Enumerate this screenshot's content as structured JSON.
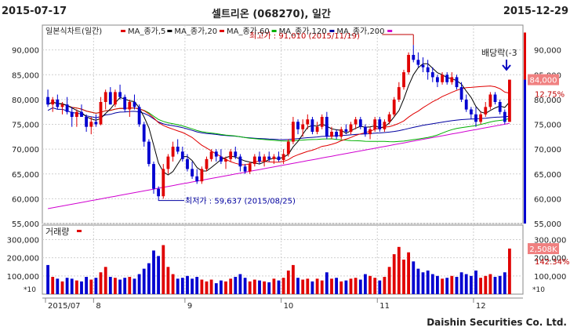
{
  "header": {
    "start_date": "2015-07-17",
    "title": "셀트리온 (068270), 일간",
    "end_date": "2015-12-29"
  },
  "footer": "Daishin Securities Co. Ltd.",
  "legend": {
    "main": "일본식차트(일간)",
    "ma": [
      {
        "label": "MA_종가,5",
        "color": "#e00000"
      },
      {
        "label": "MA_종가,20",
        "color": "#000000"
      },
      {
        "label": "MA_종가,60",
        "color": "#e00000"
      },
      {
        "label": "MA_종가,120",
        "color": "#00b000"
      },
      {
        "label": "MA_종가,200",
        "color": "#0000a0"
      },
      {
        "label": "",
        "color": "#d000d0"
      }
    ],
    "volume": "거래량"
  },
  "annotations": {
    "high": "최고가 : 91,010 (2015/11/19)",
    "low": "최저가 : 59,637 (2015/08/25)",
    "dividend": "배당락(-3",
    "last_price": "84,000",
    "last_change": "12.75%",
    "last_volume": "2,508K",
    "volume_change": "142.34%",
    "scale_note": "*10"
  },
  "colors": {
    "up": "#e00000",
    "down": "#0000d0"
  },
  "chart_data": {
    "type": "candlestick",
    "title": "셀트리온 (068270), 일간",
    "ylim": [
      55000,
      95000
    ],
    "yticks": [
      55000,
      60000,
      65000,
      70000,
      75000,
      80000,
      85000,
      90000
    ],
    "volume_ylim": [
      0,
      380000
    ],
    "volume_yticks": [
      100000,
      200000,
      300000
    ],
    "month_labels": [
      {
        "label": "2015/07",
        "index": 0
      },
      {
        "label": "8",
        "index": 10
      },
      {
        "label": "9",
        "index": 29
      },
      {
        "label": "10",
        "index": 49
      },
      {
        "label": "11",
        "index": 69
      },
      {
        "label": "12",
        "index": 89
      }
    ],
    "candles": [
      [
        80500,
        82000,
        78500,
        79000,
        160000
      ],
      [
        79000,
        80500,
        77500,
        80000,
        95000
      ],
      [
        80000,
        81000,
        78000,
        78500,
        85000
      ],
      [
        78500,
        79500,
        77000,
        79000,
        70000
      ],
      [
        79000,
        80500,
        77000,
        77500,
        90000
      ],
      [
        77500,
        78500,
        74500,
        76500,
        85000
      ],
      [
        76500,
        78000,
        74500,
        77500,
        75000
      ],
      [
        77500,
        79000,
        76500,
        76500,
        70000
      ],
      [
        76500,
        77000,
        73500,
        74500,
        95000
      ],
      [
        74500,
        76500,
        73000,
        75500,
        80000
      ],
      [
        75500,
        77000,
        74500,
        75000,
        90000
      ],
      [
        75000,
        80500,
        74800,
        79500,
        120000
      ],
      [
        79500,
        82000,
        78000,
        81500,
        150000
      ],
      [
        81500,
        82500,
        79000,
        79000,
        95000
      ],
      [
        79000,
        82000,
        78500,
        81500,
        90000
      ],
      [
        81500,
        83000,
        80000,
        80500,
        80000
      ],
      [
        80500,
        81000,
        77500,
        78000,
        90000
      ],
      [
        78000,
        80000,
        76500,
        79500,
        95000
      ],
      [
        79500,
        81000,
        78000,
        78500,
        85000
      ],
      [
        78500,
        79000,
        74500,
        75000,
        110000
      ],
      [
        75000,
        75500,
        70500,
        71500,
        140000
      ],
      [
        71500,
        72000,
        66500,
        67000,
        170000
      ],
      [
        67000,
        67500,
        61000,
        62000,
        240000
      ],
      [
        62000,
        62500,
        59600,
        60500,
        210000
      ],
      [
        60500,
        67000,
        60000,
        66000,
        270000
      ],
      [
        66000,
        69000,
        65000,
        68500,
        150000
      ],
      [
        68500,
        71500,
        67500,
        70500,
        110000
      ],
      [
        70500,
        72000,
        69000,
        69500,
        85000
      ],
      [
        69500,
        70500,
        67500,
        68000,
        90000
      ],
      [
        68000,
        69000,
        65500,
        66000,
        100000
      ],
      [
        66000,
        67500,
        64000,
        64500,
        85000
      ],
      [
        64500,
        66000,
        63000,
        63500,
        95000
      ],
      [
        63500,
        66500,
        63000,
        66000,
        80000
      ],
      [
        66000,
        68500,
        65500,
        68000,
        70000
      ],
      [
        68000,
        70000,
        67500,
        69500,
        80000
      ],
      [
        69500,
        70000,
        67500,
        68500,
        60000
      ],
      [
        68500,
        70000,
        67000,
        67500,
        75000
      ],
      [
        67500,
        68500,
        66000,
        68000,
        70000
      ],
      [
        68000,
        70000,
        67500,
        69500,
        85000
      ],
      [
        69500,
        70500,
        68000,
        68500,
        95000
      ],
      [
        68500,
        69000,
        65500,
        66500,
        110000
      ],
      [
        66500,
        67000,
        65000,
        65500,
        90000
      ],
      [
        65500,
        67500,
        65000,
        67000,
        70000
      ],
      [
        67000,
        69000,
        66500,
        68500,
        80000
      ],
      [
        68500,
        69500,
        67000,
        67500,
        75000
      ],
      [
        67500,
        69000,
        66500,
        68500,
        70000
      ],
      [
        68500,
        69500,
        67500,
        68000,
        65000
      ],
      [
        68000,
        69000,
        67000,
        68500,
        85000
      ],
      [
        68500,
        69500,
        67500,
        67800,
        75000
      ],
      [
        67800,
        70000,
        67000,
        69000,
        90000
      ],
      [
        69000,
        72000,
        68500,
        71500,
        130000
      ],
      [
        71500,
        76500,
        71000,
        75500,
        160000
      ],
      [
        75500,
        76000,
        73000,
        74000,
        90000
      ],
      [
        74000,
        76000,
        72500,
        75000,
        80000
      ],
      [
        75000,
        77000,
        74000,
        76000,
        85000
      ],
      [
        76000,
        76500,
        73000,
        73500,
        70000
      ],
      [
        73500,
        75500,
        73000,
        74500,
        85000
      ],
      [
        74500,
        77000,
        74000,
        76500,
        75000
      ],
      [
        76500,
        77500,
        72000,
        72500,
        120000
      ],
      [
        72500,
        74500,
        72000,
        73500,
        85000
      ],
      [
        73500,
        74000,
        72000,
        72500,
        90000
      ],
      [
        72500,
        74500,
        72000,
        74000,
        70000
      ],
      [
        74000,
        75000,
        73000,
        73500,
        75000
      ],
      [
        73500,
        75500,
        73000,
        75000,
        85000
      ],
      [
        75000,
        76500,
        74000,
        76000,
        90000
      ],
      [
        76000,
        76500,
        74000,
        74500,
        80000
      ],
      [
        74500,
        75000,
        72500,
        73000,
        110000
      ],
      [
        73000,
        74500,
        72000,
        74000,
        100000
      ],
      [
        74000,
        76500,
        73500,
        76000,
        90000
      ],
      [
        76000,
        76500,
        73500,
        74000,
        75000
      ],
      [
        74000,
        76000,
        73500,
        75500,
        95000
      ],
      [
        75500,
        77500,
        75000,
        77000,
        150000
      ],
      [
        77000,
        80500,
        76500,
        80000,
        220000
      ],
      [
        80000,
        83500,
        79500,
        82500,
        260000
      ],
      [
        82500,
        86000,
        82000,
        85500,
        190000
      ],
      [
        85500,
        89500,
        85000,
        89000,
        230000
      ],
      [
        89000,
        91010,
        87500,
        88000,
        180000
      ],
      [
        88000,
        89500,
        86500,
        87000,
        140000
      ],
      [
        87000,
        88500,
        85500,
        86500,
        120000
      ],
      [
        86500,
        88000,
        84000,
        85500,
        130000
      ],
      [
        85500,
        86500,
        83500,
        84500,
        110000
      ],
      [
        84500,
        85000,
        82500,
        83500,
        100000
      ],
      [
        83500,
        85500,
        83000,
        85000,
        85000
      ],
      [
        85000,
        85500,
        83000,
        83500,
        90000
      ],
      [
        83500,
        85500,
        83000,
        84500,
        100000
      ],
      [
        84500,
        85000,
        82000,
        82500,
        95000
      ],
      [
        82500,
        83500,
        79500,
        80000,
        120000
      ],
      [
        80000,
        81000,
        77500,
        78000,
        110000
      ],
      [
        78000,
        78500,
        76000,
        77000,
        100000
      ],
      [
        77000,
        78500,
        74500,
        75500,
        130000
      ],
      [
        75500,
        77500,
        75000,
        77000,
        90000
      ],
      [
        77000,
        79500,
        76500,
        78500,
        100000
      ],
      [
        78500,
        81500,
        78000,
        81000,
        110000
      ],
      [
        81000,
        81500,
        79000,
        79500,
        95000
      ],
      [
        79500,
        80000,
        77000,
        77500,
        100000
      ],
      [
        77500,
        78000,
        75000,
        75500,
        120000
      ],
      [
        75500,
        84000,
        75500,
        84000,
        250800
      ]
    ]
  }
}
